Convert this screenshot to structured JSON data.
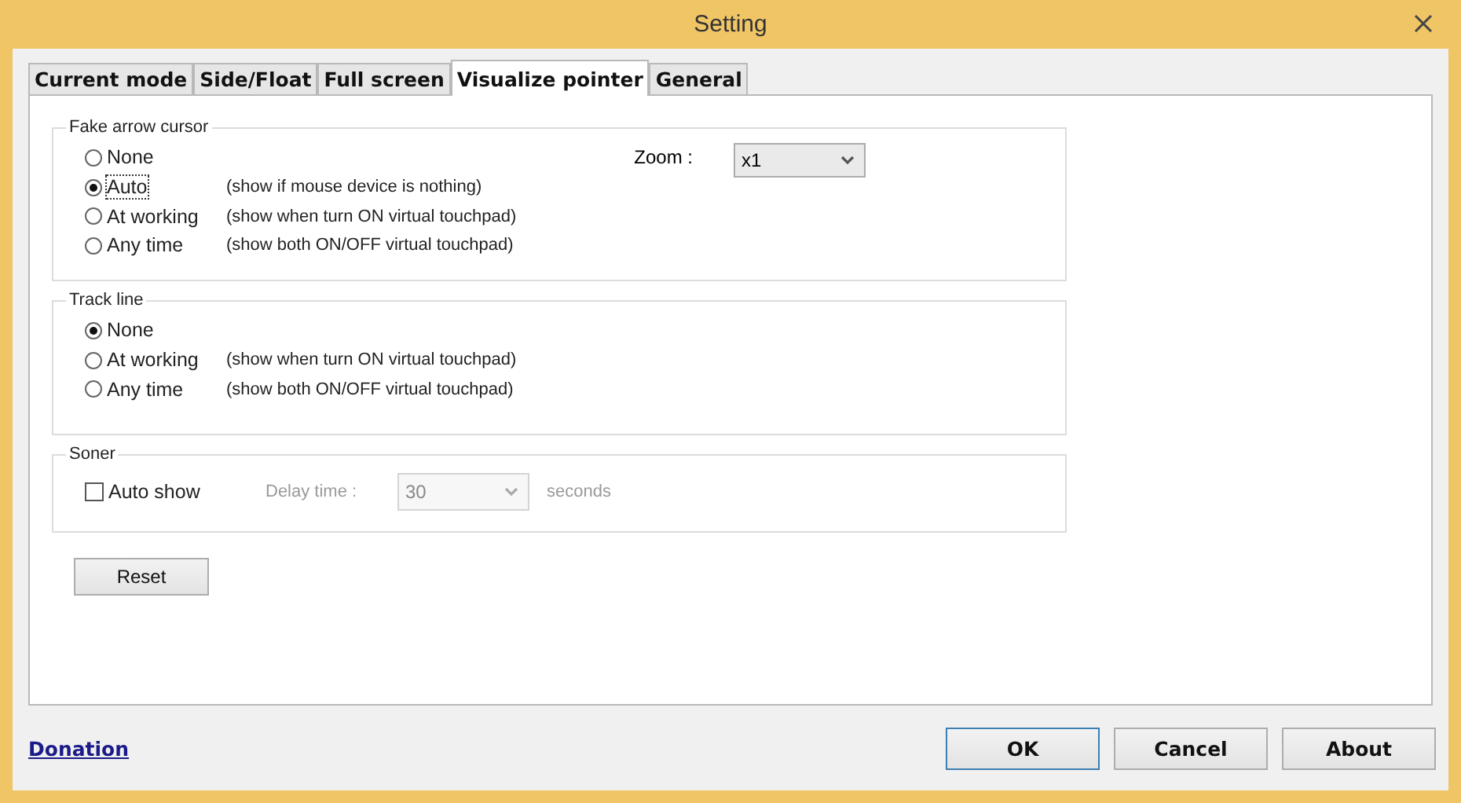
{
  "window": {
    "title": "Setting"
  },
  "tabs": [
    {
      "label": "Current mode",
      "selected": false
    },
    {
      "label": "Side/Float",
      "selected": false
    },
    {
      "label": "Full screen",
      "selected": false
    },
    {
      "label": "Visualize pointer",
      "selected": true
    },
    {
      "label": "General",
      "selected": false
    }
  ],
  "fake_arrow_cursor": {
    "title": "Fake arrow cursor",
    "zoom_label": "Zoom :",
    "zoom_value": "x1",
    "options": [
      {
        "label": "None",
        "selected": false,
        "focused": false
      },
      {
        "label": "Auto",
        "note": "(show if mouse device is nothing)",
        "selected": true,
        "focused": true
      },
      {
        "label": "At working",
        "note": "(show when turn ON virtual touchpad)",
        "selected": false,
        "focused": false
      },
      {
        "label": "Any time",
        "note": "(show both ON/OFF virtual touchpad)",
        "selected": false,
        "focused": false
      }
    ]
  },
  "track_line": {
    "title": "Track line",
    "options": [
      {
        "label": "None",
        "selected": true,
        "focused": false
      },
      {
        "label": "At working",
        "note": "(show when turn ON virtual touchpad)",
        "selected": false,
        "focused": false
      },
      {
        "label": "Any time",
        "note": "(show both ON/OFF virtual touchpad)",
        "selected": false,
        "focused": false
      }
    ]
  },
  "soner": {
    "title": "Soner",
    "auto_show": {
      "label": "Auto show",
      "checked": false
    },
    "delay": {
      "label": "Delay time :",
      "value": "30",
      "unit": "seconds",
      "disabled": true
    }
  },
  "reset_button": "Reset",
  "donation_link": "Donation",
  "buttons": [
    {
      "label": "OK",
      "default": true
    },
    {
      "label": "Cancel",
      "default": false
    },
    {
      "label": "About",
      "default": false
    }
  ]
}
